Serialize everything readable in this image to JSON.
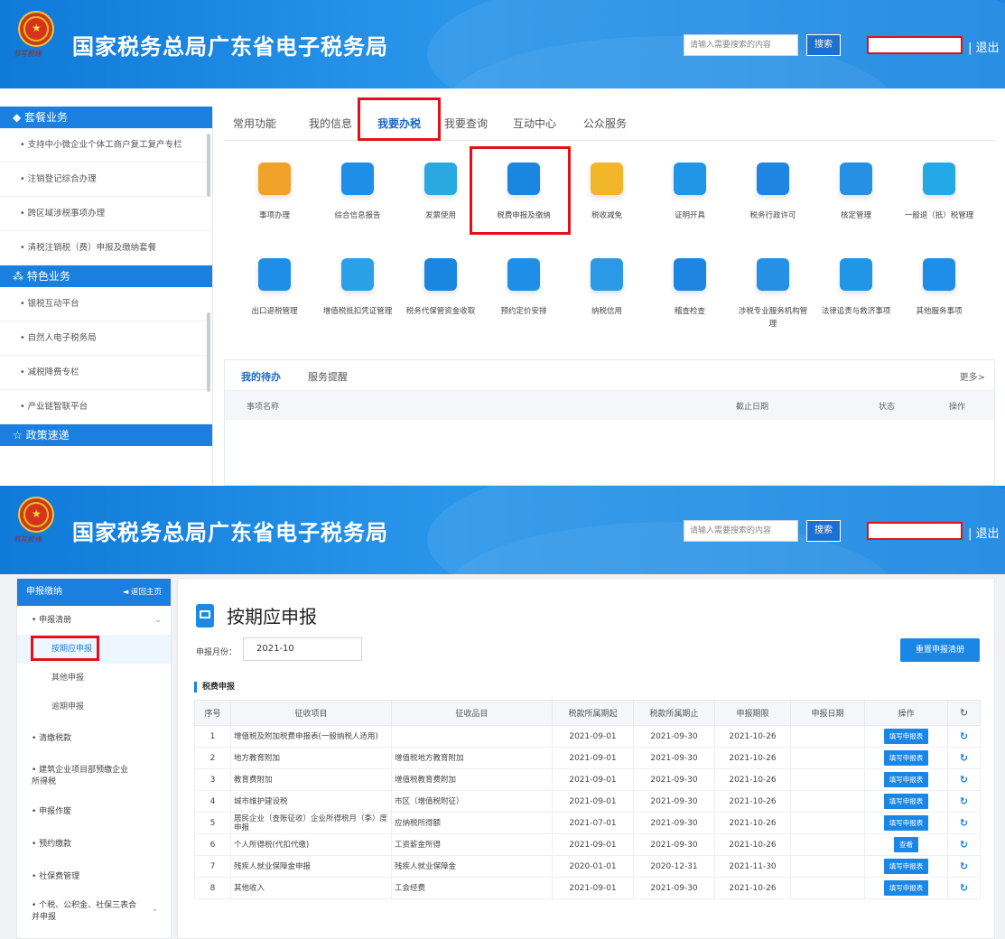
{
  "header": {
    "title": "国家税务总局广东省电子税务局",
    "search_placeholder": "请输入需要搜索的内容",
    "search_button": "搜索",
    "logout": "| 退出",
    "emblem_signature": "书写税缘"
  },
  "top": {
    "sidebar": {
      "section1": "套餐业务",
      "items1": [
        "支持中小微企业个体工商户复工复产专栏",
        "注销登记综合办理",
        "跨区域涉税事项办理",
        "清税注销税（费）申报及缴纳套餐"
      ],
      "section2": "特色业务",
      "items2": [
        "银税互动平台",
        "自然人电子税务局",
        "减税降费专栏",
        "产业链智联平台"
      ],
      "section3": "政策速递"
    },
    "nav": [
      "常用功能",
      "我的信息",
      "我要办税",
      "我要查询",
      "互动中心",
      "公众服务"
    ],
    "active_nav": "我要办税",
    "tiles_row1": [
      {
        "label": "事项办理",
        "icon": "pencil-icon",
        "color": "#f0a22a"
      },
      {
        "label": "综合信息报告",
        "icon": "document-icon",
        "color": "#1e8ee8"
      },
      {
        "label": "发票使用",
        "icon": "invoice-icon",
        "color": "#2aa8e0"
      },
      {
        "label": "税费申报及缴纳",
        "icon": "cube-icon",
        "color": "#1a86e0"
      },
      {
        "label": "税收减免",
        "icon": "coin-icon",
        "color": "#f2b62b"
      },
      {
        "label": "证明开具",
        "icon": "certificate-icon",
        "color": "#2296e6"
      },
      {
        "label": "税务行政许可",
        "icon": "id-card-icon",
        "color": "#1e86e2"
      },
      {
        "label": "核定管理",
        "icon": "user-gear-icon",
        "color": "#2690e4"
      },
      {
        "label": "一般退（抵）税管理",
        "icon": "refund-icon",
        "color": "#24a8e6"
      }
    ],
    "tiles_row2": [
      {
        "label": "出口退税管理",
        "icon": "export-icon",
        "color": "#1e8ee8"
      },
      {
        "label": "增值税抵扣凭证管理",
        "icon": "ledger-icon",
        "color": "#2aa0e6"
      },
      {
        "label": "税务代保管资金收取",
        "icon": "money-bag-icon",
        "color": "#1a86e0"
      },
      {
        "label": "预约定价安排",
        "icon": "calendar-icon",
        "color": "#1e8ee8"
      },
      {
        "label": "纳税信用",
        "icon": "shield-check-icon",
        "color": "#2a9ae6"
      },
      {
        "label": "稽查检查",
        "icon": "user-search-icon",
        "color": "#1e86e2"
      },
      {
        "label": "涉税专业服务机构管理",
        "icon": "user-settings-icon",
        "color": "#2690e4"
      },
      {
        "label": "法律追责与救济事项",
        "icon": "gavel-icon",
        "color": "#2296e6"
      },
      {
        "label": "其他服务事项",
        "icon": "doc-add-icon",
        "color": "#1e8ee8"
      }
    ],
    "todo": {
      "tab1": "我的待办",
      "tab2": "服务提醒",
      "more": "更多>",
      "col_name": "事项名称",
      "col_deadline": "截止日期",
      "col_status": "状态",
      "col_action": "操作"
    }
  },
  "bottom": {
    "sidebar": {
      "head": "申报缴纳",
      "back": "◄ 返回主页",
      "group1": "申报清册",
      "subs": [
        "按期应申报",
        "其他申报",
        "逾期申报"
      ],
      "active_sub": "按期应申报",
      "items": [
        "清缴税款",
        "建筑企业项目部预缴企业所得税",
        "申报作废",
        "预约缴款",
        "社保费管理",
        "个税、公积金、社保三表合并申报"
      ]
    },
    "page_title": "按期应申报",
    "period_label": "申报月份：",
    "period_value": "2021-10",
    "reset_button": "重置申报清册",
    "section": "税费申报",
    "columns": [
      "序号",
      "征收项目",
      "征收品目",
      "税款所属期起",
      "税款所属期止",
      "申报期限",
      "申报日期",
      "操作",
      "↻"
    ],
    "rows": [
      {
        "no": "1",
        "item": "增值税及附加税费申报表(一般纳税人适用)",
        "sub": "",
        "from": "2021-09-01",
        "to": "2021-09-30",
        "due": "2021-10-26",
        "date": "",
        "action": "填写申报表"
      },
      {
        "no": "2",
        "item": "地方教育附加",
        "sub": "增值税地方教育附加",
        "from": "2021-09-01",
        "to": "2021-09-30",
        "due": "2021-10-26",
        "date": "",
        "action": "填写申报表"
      },
      {
        "no": "3",
        "item": "教育费附加",
        "sub": "增值税教育费附加",
        "from": "2021-09-01",
        "to": "2021-09-30",
        "due": "2021-10-26",
        "date": "",
        "action": "填写申报表"
      },
      {
        "no": "4",
        "item": "城市维护建设税",
        "sub": "市区（增值税附征）",
        "from": "2021-09-01",
        "to": "2021-09-30",
        "due": "2021-10-26",
        "date": "",
        "action": "填写申报表"
      },
      {
        "no": "5",
        "item": "居民企业（查账征收）企业所得税月（季）度申报",
        "sub": "应纳税所得额",
        "from": "2021-07-01",
        "to": "2021-09-30",
        "due": "2021-10-26",
        "date": "",
        "action": "填写申报表"
      },
      {
        "no": "6",
        "item": "个人所得税(代扣代缴)",
        "sub": "工资薪金所得",
        "from": "2021-09-01",
        "to": "2021-09-30",
        "due": "2021-10-26",
        "date": "",
        "action": "查看"
      },
      {
        "no": "7",
        "item": "残疾人就业保障金申报",
        "sub": "残疾人就业保障金",
        "from": "2020-01-01",
        "to": "2020-12-31",
        "due": "2021-11-30",
        "date": "",
        "action": "填写申报表"
      },
      {
        "no": "8",
        "item": "其他收入",
        "sub": "工会经费",
        "from": "2021-09-01",
        "to": "2021-09-30",
        "due": "2021-10-26",
        "date": "",
        "action": "填写申报表"
      }
    ]
  }
}
